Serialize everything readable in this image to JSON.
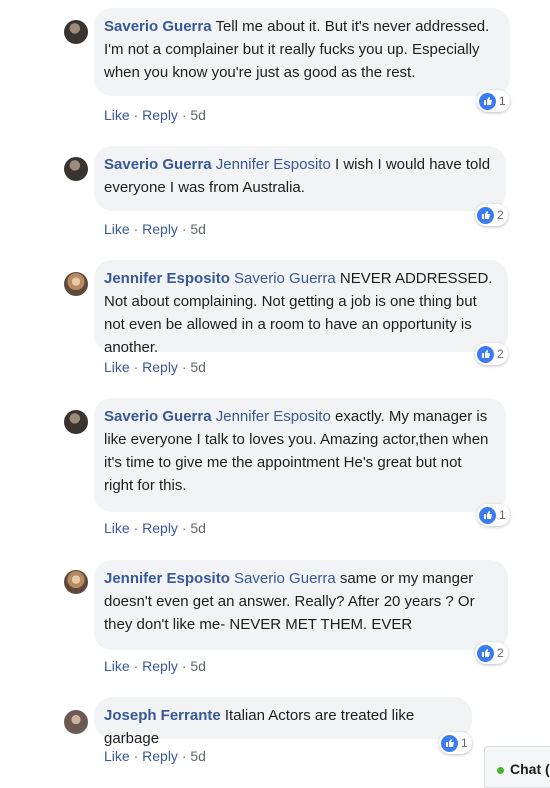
{
  "comments": [
    {
      "author": "Saverio Guerra",
      "mention": "",
      "text": "Tell me about it. But it's never addressed. I'm not a complainer but it really fucks you up. Especially when you know you're just as good as the rest.",
      "like": "Like",
      "reply": "Reply",
      "time": "5d",
      "reactions": "1"
    },
    {
      "author": "Saverio Guerra",
      "mention": "Jennifer Esposito",
      "text": "I wish I would have told everyone I was from Australia.",
      "like": "Like",
      "reply": "Reply",
      "time": "5d",
      "reactions": "2"
    },
    {
      "author": "Jennifer Esposito",
      "mention": "Saverio Guerra",
      "text": "NEVER ADDRESSED. Not about complaining. Not getting a job is one thing but not even be allowed in a room to have an opportunity is another.",
      "like": "Like",
      "reply": "Reply",
      "time": "5d",
      "reactions": "2"
    },
    {
      "author": "Saverio Guerra",
      "mention": "Jennifer Esposito",
      "text": "exactly. My manager is like everyone I talk to loves you. Amazing actor,then when it's time to give me the appointment He's great but not right for this.",
      "like": "Like",
      "reply": "Reply",
      "time": "5d",
      "reactions": "1"
    },
    {
      "author": "Jennifer Esposito",
      "mention": "Saverio Guerra",
      "text": "same or my manger doesn't even get an answer. Really? After 20 years ? Or they don't like me- NEVER MET THEM. EVER",
      "like": "Like",
      "reply": "Reply",
      "time": "5d",
      "reactions": "2"
    },
    {
      "author": "Joseph Ferrante",
      "mention": "",
      "text": "Italian Actors are treated like garbage",
      "like": "Like",
      "reply": "Reply",
      "time": "5d",
      "reactions": "1"
    }
  ],
  "chat": {
    "label": "Chat ("
  },
  "colors": {
    "link": "#385898",
    "bubble": "#f2f3f5",
    "like_blue": "#3b7df0",
    "online_green": "#42b72a"
  }
}
